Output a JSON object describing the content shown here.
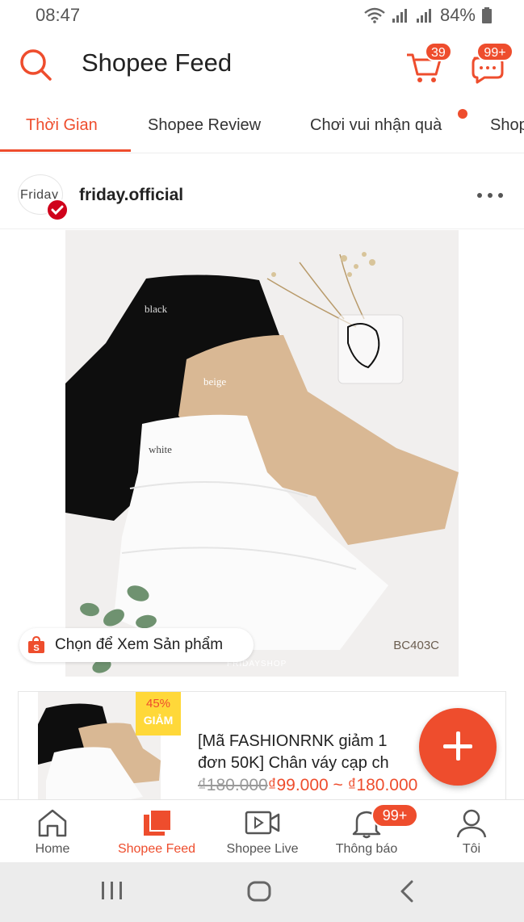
{
  "status_bar": {
    "time": "08:47",
    "battery": "84%"
  },
  "header": {
    "title": "Shopee Feed",
    "cart_badge": "39",
    "chat_badge": "99+"
  },
  "tabs": [
    {
      "label": "Thời Gian",
      "active": true
    },
    {
      "label": "Shopee Review",
      "active": false
    },
    {
      "label": "Chơi vui nhận quà",
      "active": false,
      "dot": true
    },
    {
      "label": "Shop",
      "active": false
    }
  ],
  "post": {
    "avatar_text": "Friday",
    "shop_name": "friday.official",
    "image": {
      "labels": [
        "black",
        "beige",
        "white"
      ],
      "code": "BC403C",
      "watermark": "FRIDAYSHOP"
    },
    "view_product_label": "Chọn để Xem Sản phẩm"
  },
  "product": {
    "discount_percent": "45%",
    "discount_text": "GIẢM",
    "title_line1": "[Mã FASHIONRNK giảm 1",
    "title_line2": "đơn 50K] Chân váy cạp ch",
    "price_old": "₫180.000",
    "price_new": "₫99.000 ~ ₫180.000"
  },
  "bottom_nav": [
    {
      "label": "Home",
      "active": false
    },
    {
      "label": "Shopee Feed",
      "active": true
    },
    {
      "label": "Shopee Live",
      "active": false
    },
    {
      "label": "Thông báo",
      "active": false,
      "badge": "99+"
    },
    {
      "label": "Tôi",
      "active": false
    }
  ],
  "colors": {
    "accent": "#ee4d2d",
    "text": "#222222",
    "muted": "#999999"
  }
}
